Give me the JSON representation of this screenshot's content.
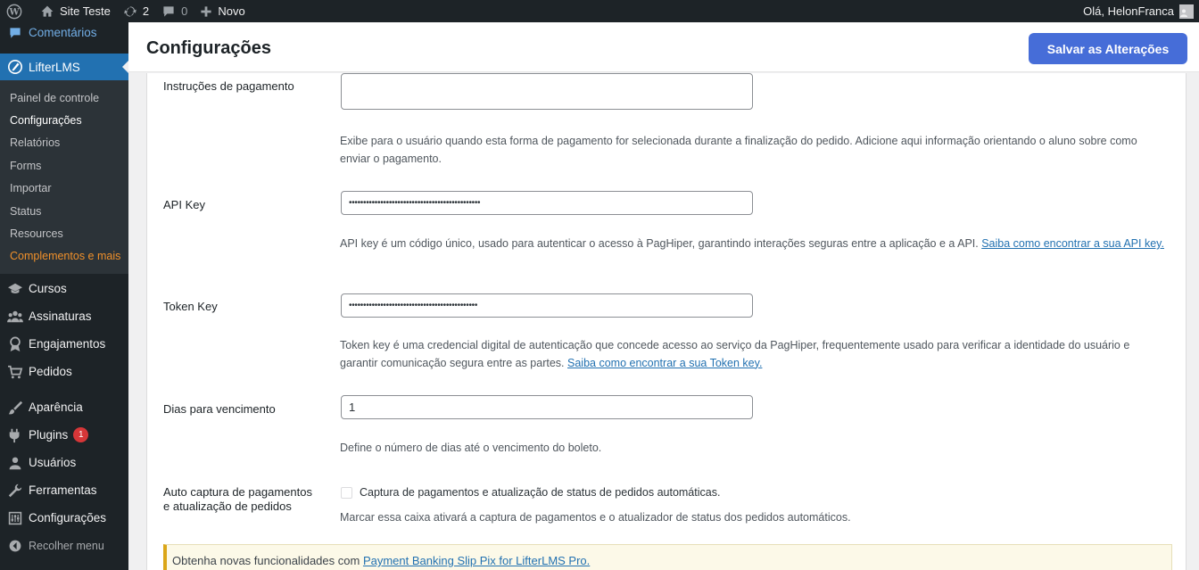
{
  "admin_bar": {
    "site_name": "Site Teste",
    "updates_count": "2",
    "comments_count": "0",
    "new_label": "Novo",
    "greeting": "Olá, HelonFranca"
  },
  "sidebar": {
    "comments_label": "Comentários",
    "lifterlms_label": "LifterLMS",
    "submenu": [
      "Painel de controle",
      "Configurações",
      "Relatórios",
      "Forms",
      "Importar",
      "Status",
      "Resources",
      "Complementos e mais"
    ],
    "items": [
      "Cursos",
      "Assinaturas",
      "Engajamentos",
      "Pedidos",
      "Aparência",
      "Plugins",
      "Usuários",
      "Ferramentas",
      "Configurações",
      "Recolher menu"
    ],
    "plugins_badge": "1"
  },
  "header": {
    "title": "Configurações",
    "save_label": "Salvar as Alterações"
  },
  "form": {
    "instructions": {
      "label": "Instruções de pagamento",
      "value": "",
      "description": "Exibe para o usuário quando esta forma de pagamento for selecionada durante a finalização do pedido. Adicione aqui informação orientando o aluno sobre como enviar o pagamento."
    },
    "api_key": {
      "label": "API Key",
      "value": "••••••••••••••••••••••••••••••••••••••••••••••",
      "description": "API key é um código único, usado para autenticar o acesso à PagHiper, garantindo interações seguras entre a aplicação e a API.",
      "link": "Saiba como encontrar a sua API key."
    },
    "token_key": {
      "label": "Token Key",
      "value": "•••••••••••••••••••••••••••••••••••••••••••••",
      "description": "Token key é uma credencial digital de autenticação que concede acesso ao serviço da PagHiper, frequentemente usado para verificar a identidade do usuário e garantir comunicação segura entre as partes.",
      "link": "Saiba como encontrar a sua Token key."
    },
    "due_days": {
      "label": "Dias para vencimento",
      "value": "1",
      "description": "Define o número de dias até o vencimento do boleto."
    },
    "auto_capture": {
      "label_line1": "Auto captura de pagamentos",
      "label_line2": "e atualização de pedidos",
      "checkbox_label": "Captura de pagamentos e atualização de status de pedidos automáticas.",
      "checked": false,
      "description": "Marcar essa caixa ativará a captura de pagamentos e o atualizador de status dos pedidos automáticos."
    }
  },
  "notice": {
    "text": "Obtenha novas funcionalidades com",
    "link": "Payment Banking Slip Pix for LifterLMS Pro."
  }
}
